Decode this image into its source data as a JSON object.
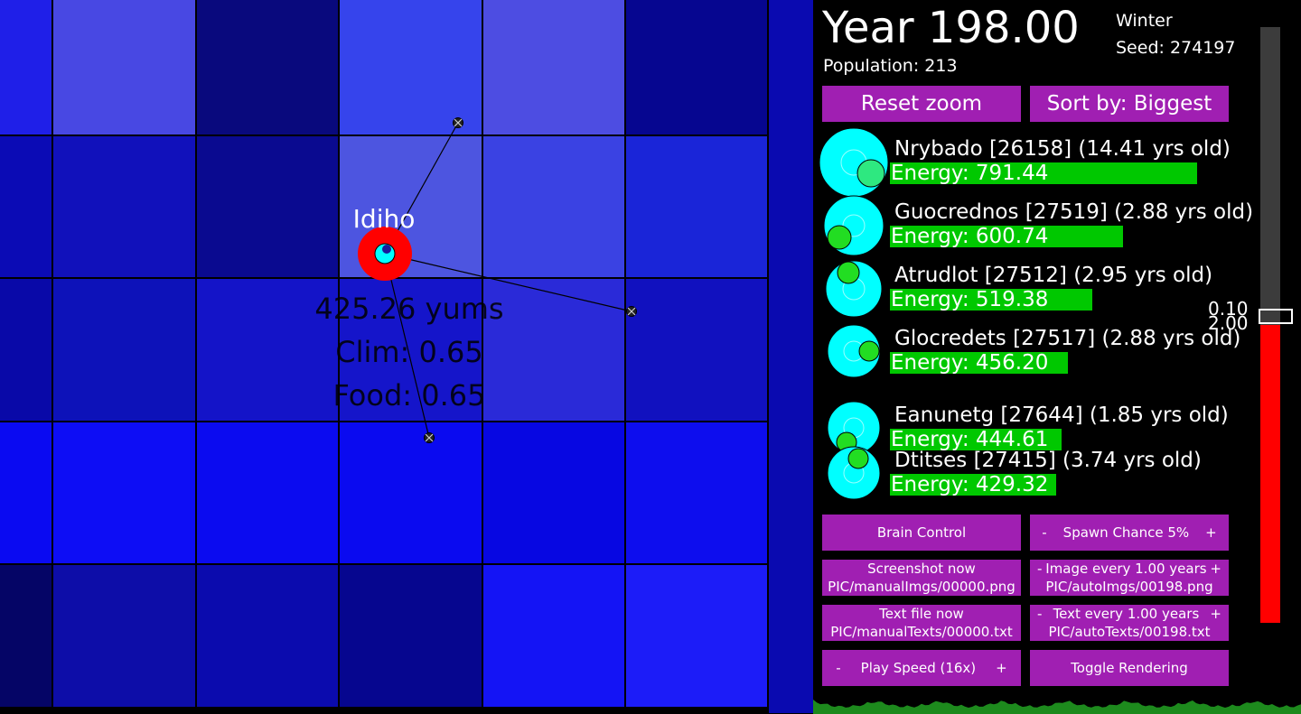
{
  "world": {
    "selected_creature": {
      "name": "Idiho",
      "energy": "425.26 yums",
      "climate": "Clim: 0.65",
      "food": "Food: 0.65"
    },
    "tile_colors": [
      [
        "#1f1fe8",
        "#4848e3",
        "#09097d",
        "#3644ec",
        "#4d4de2",
        "#060690"
      ],
      [
        "#0b0bb5",
        "#1111bb",
        "#0a0a90",
        "#4d55e0",
        "#3a42e3",
        "#1a25d8"
      ],
      [
        "#0909a8",
        "#0d12b9",
        "#1414c8",
        "#1515ca",
        "#2a2ad8",
        "#1111bf"
      ],
      [
        "#0a0af2",
        "#0d0df5",
        "#0b0bf0",
        "#0a0af0",
        "#0707e2",
        "#0d0dee"
      ],
      [
        "#050566",
        "#0d0da8",
        "#0b0bae",
        "#06068f",
        "#1414f5",
        "#1c1cf8"
      ]
    ]
  },
  "panel": {
    "year": "Year 198.00",
    "population": "Population: 213",
    "season": "Winter",
    "seed": "Seed: 274197",
    "reset_zoom": "Reset zoom",
    "sort_by": "Sort by: Biggest",
    "creatures": [
      {
        "name": "Nrybado [26158] (14.41 yrs old)",
        "energy": "Energy: 791.44",
        "energy_fraction": 1.0
      },
      {
        "name": "Guocrednos [27519] (2.88 yrs old)",
        "energy": "Energy: 600.74",
        "energy_fraction": 0.76
      },
      {
        "name": "Atrudlot [27512] (2.95 yrs old)",
        "energy": "Energy: 519.38",
        "energy_fraction": 0.66
      },
      {
        "name": "Glocredets [27517] (2.88 yrs old)",
        "energy": "Energy: 456.20",
        "energy_fraction": 0.58
      },
      {
        "name": "Eanunetg [27644] (1.85 yrs old)",
        "energy": "Energy: 444.61",
        "energy_fraction": 0.56
      },
      {
        "name": "Dtitses [27415] (3.74 yrs old)",
        "energy": "Energy: 429.32",
        "energy_fraction": 0.54
      }
    ],
    "brain_control": "Brain Control",
    "spawn_minus": "-",
    "spawn_label": "Spawn Chance 5%",
    "spawn_plus": "+",
    "screenshot_now": "Screenshot now",
    "screenshot_path": "PIC/manualImgs/00000.png",
    "image_minus": "-",
    "image_every": "Image every 1.00 years",
    "image_plus": "+",
    "image_path": "PIC/autoImgs/00198.png",
    "text_file_now": "Text file now",
    "text_file_path": "PIC/manualTexts/00000.txt",
    "text_minus": "-",
    "text_every": "Text every 1.00 years",
    "text_plus": "+",
    "text_path": "PIC/autoTexts/00198.txt",
    "speed_minus": "-",
    "play_speed": "Play Speed (16x)",
    "speed_plus": "+",
    "toggle_rendering": "Toggle Rendering",
    "slider_value_top": "0.10",
    "slider_value_bottom": "2.00",
    "slider_fill_fraction": 0.5
  }
}
